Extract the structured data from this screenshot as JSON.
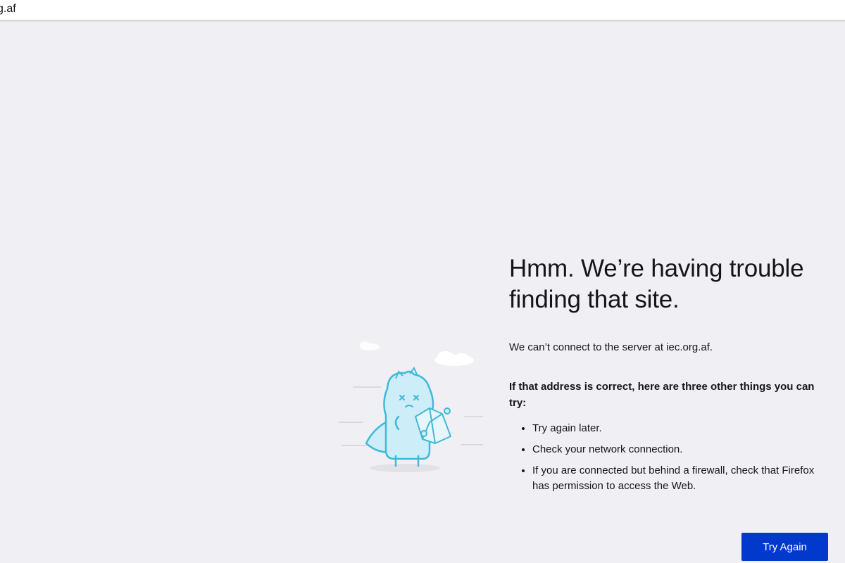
{
  "urlbar": {
    "text": "g.af"
  },
  "error": {
    "title": "Hmm. We’re having trouble finding that site.",
    "short_desc": "We can’t connect to the server at iec.org.af.",
    "suggest_heading": "If that address is correct, here are three other things you can try:",
    "suggestions": [
      "Try again later.",
      "Check your network connection.",
      "If you are connected but behind a firewall, check that Firefox has permission to access the Web."
    ],
    "try_again_label": "Try Again"
  },
  "colors": {
    "background": "#f0f0f4",
    "button": "#0039cb",
    "illustration_fill": "#cdeef8",
    "illustration_stroke": "#3fb9d9"
  }
}
